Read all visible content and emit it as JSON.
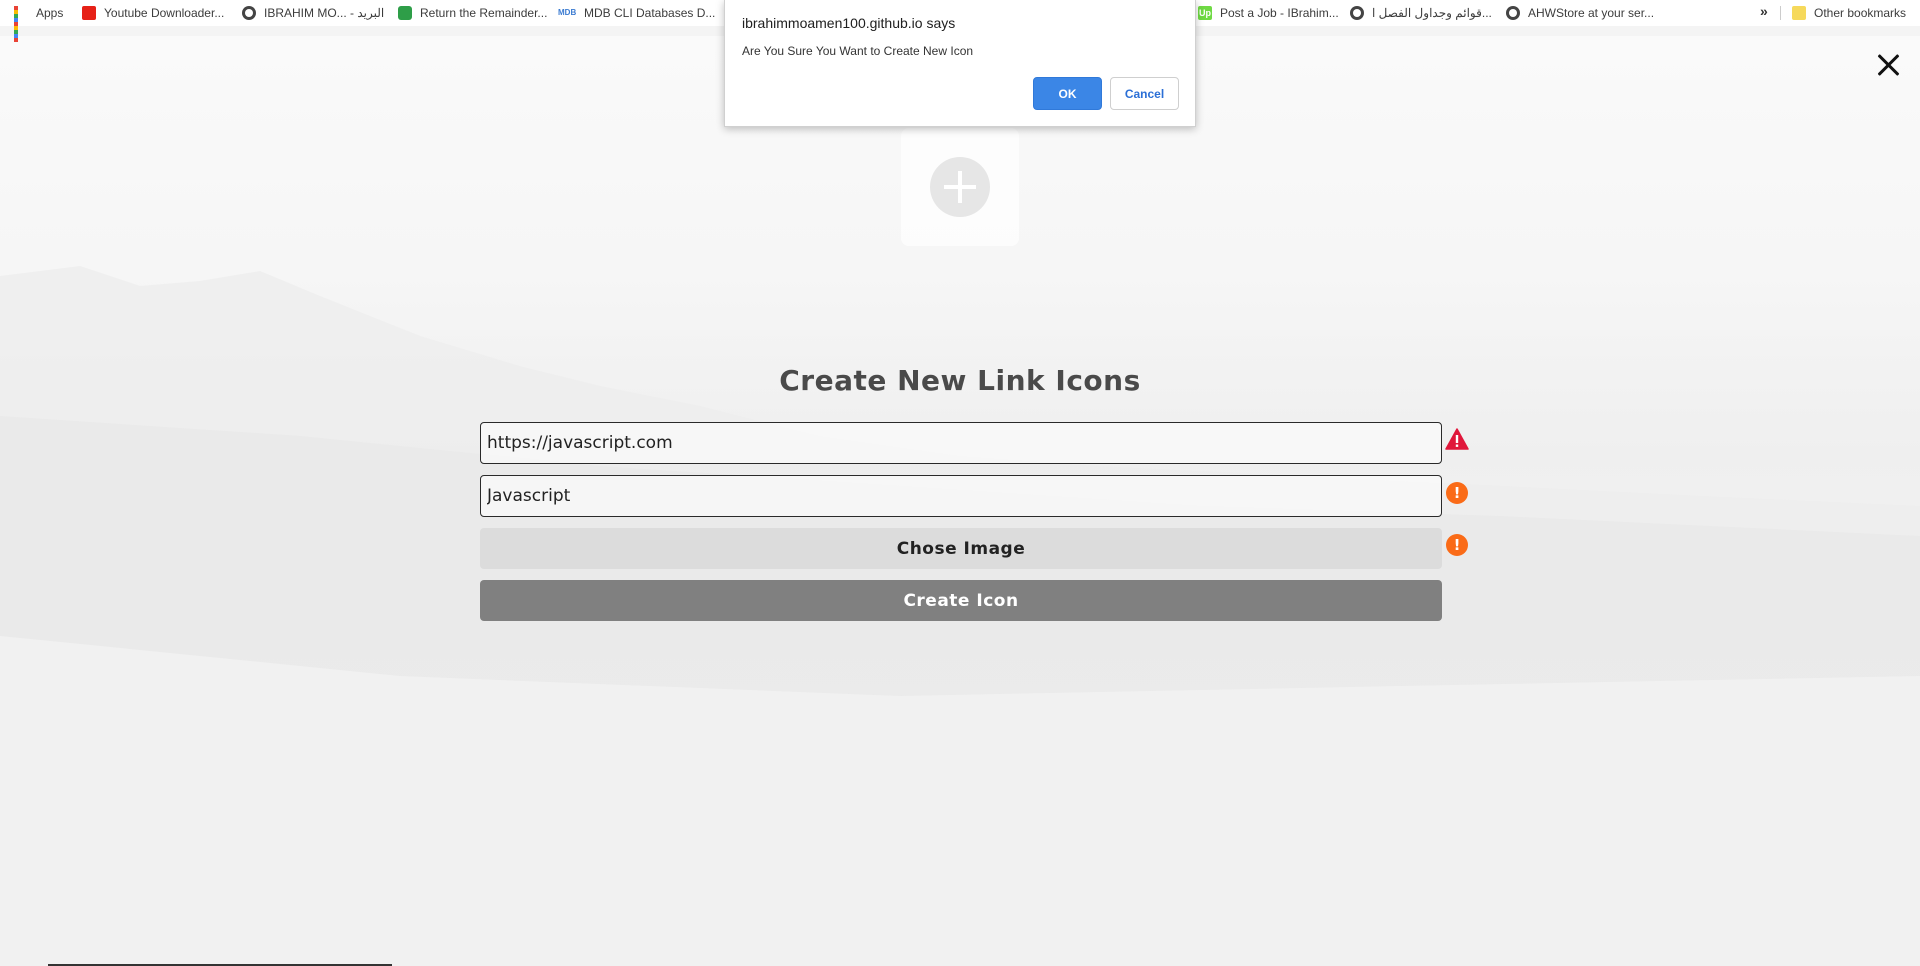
{
  "bookmarks": {
    "items": [
      {
        "label": "Apps",
        "icon": "apps-grid-icon"
      },
      {
        "label": "Youtube Downloader...",
        "icon": "youtube-icon"
      },
      {
        "label": "IBRAHIM MO... - البريد",
        "icon": "globe-icon"
      },
      {
        "label": "Return the Remainder...",
        "icon": "green-app-icon"
      },
      {
        "label": "MDB CLI Databases D...",
        "icon": "mdb-icon"
      },
      {
        "label": "Post a Job - IBrahim...",
        "icon": "upwork-icon"
      },
      {
        "label": "قوائم وجداول الفصل ا...",
        "icon": "globe-icon"
      },
      {
        "label": "AHWStore at your ser...",
        "icon": "globe-icon"
      }
    ],
    "more_label": "»",
    "other_label": "Other bookmarks"
  },
  "dialog": {
    "title": "ibrahimmoamen100.github.io says",
    "message": "Are You Sure You Want to Create New Icon",
    "ok_label": "OK",
    "cancel_label": "Cancel"
  },
  "form": {
    "title": "Create New Link Icons",
    "url_value": "https://javascript.com",
    "name_value": "Javascript",
    "choose_image_label": "Chose Image",
    "create_label": "Create Icon"
  },
  "colors": {
    "ok_blue": "#3b86e6",
    "warning_red": "#e0173b",
    "warning_orange": "#fa6b17",
    "create_button": "#808080"
  }
}
